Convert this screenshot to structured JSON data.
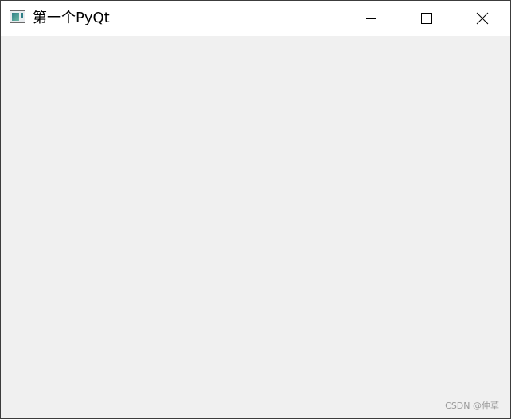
{
  "window": {
    "title": "第一个PyQt",
    "icon": "app-window-icon",
    "controls": {
      "minimize_icon": "minimize-icon",
      "maximize_icon": "maximize-icon",
      "close_icon": "close-icon"
    }
  },
  "content": {
    "watermark": "CSDN @仲草"
  },
  "colors": {
    "titlebar_bg": "#ffffff",
    "client_bg": "#f0f0f0",
    "border": "#3c3c3c",
    "watermark": "#9a9a9a"
  }
}
